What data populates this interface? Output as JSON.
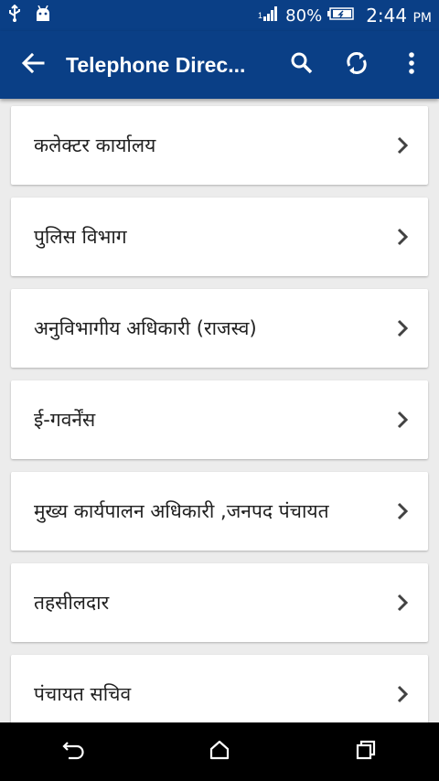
{
  "status_bar": {
    "battery": "80%",
    "time": "2:44",
    "ampm": "PM",
    "icons": [
      "usb-icon",
      "android-debug-icon",
      "signal-icon",
      "battery-icon"
    ]
  },
  "app_bar": {
    "title": "Telephone Direc...",
    "icons": [
      "back-arrow-icon",
      "search-icon",
      "sync-icon",
      "more-vert-icon"
    ]
  },
  "colors": {
    "primary": "#0a3f86",
    "background": "#ececec",
    "card": "#ffffff",
    "text": "#212121",
    "chevron": "#424242"
  },
  "departments": [
    {
      "label": "कलेक्टर कार्यालय"
    },
    {
      "label": "पुलिस विभाग"
    },
    {
      "label": "अनुविभागीय अधिकारी (राजस्व)"
    },
    {
      "label": "ई-गवर्नेंस"
    },
    {
      "label": "मुख्य कार्यपालन अधिकारी ,जनपद पंचायत"
    },
    {
      "label": "तहसीलदार"
    },
    {
      "label": "पंचायत सचिव"
    }
  ],
  "nav_bar": {
    "icons": [
      "back-icon",
      "home-icon",
      "recents-icon"
    ]
  }
}
